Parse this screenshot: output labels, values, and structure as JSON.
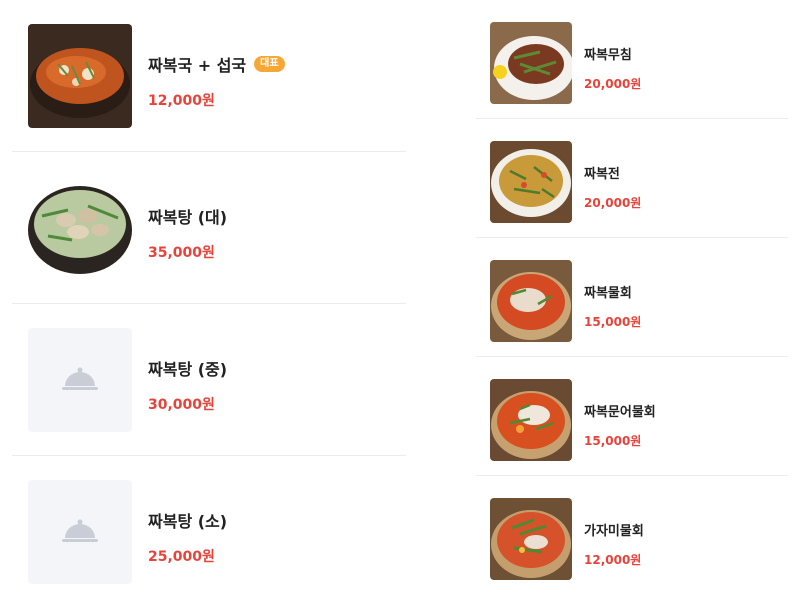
{
  "left_menu": [
    {
      "name": "짜복국 + 섭국",
      "badge": "대표",
      "price": "12,000원",
      "photo": "clam-soup-pot"
    },
    {
      "name": "짜복탕 (대)",
      "price": "35,000원",
      "photo": "clam-stew-bowl"
    },
    {
      "name": "짜복탕 (중)",
      "price": "30,000원",
      "photo": "placeholder"
    },
    {
      "name": "짜복탕 (소)",
      "price": "25,000원",
      "photo": "placeholder"
    }
  ],
  "right_menu": [
    {
      "name": "짜복무침",
      "price": "20,000원",
      "photo": "seasoned-plate"
    },
    {
      "name": "짜복전",
      "price": "20,000원",
      "photo": "pancake-plate"
    },
    {
      "name": "짜복물회",
      "price": "15,000원",
      "photo": "cold-soup-bowl"
    },
    {
      "name": "짜복문어물회",
      "price": "15,000원",
      "photo": "octopus-cold-soup-bowl"
    },
    {
      "name": "가자미물회",
      "price": "12,000원",
      "photo": "flounder-cold-soup-bowl"
    }
  ],
  "colors": {
    "price": "#e8433a",
    "badge": "#f7a736",
    "placeholder_bg": "#f3f5f8",
    "placeholder_icon": "#c9ced6"
  }
}
